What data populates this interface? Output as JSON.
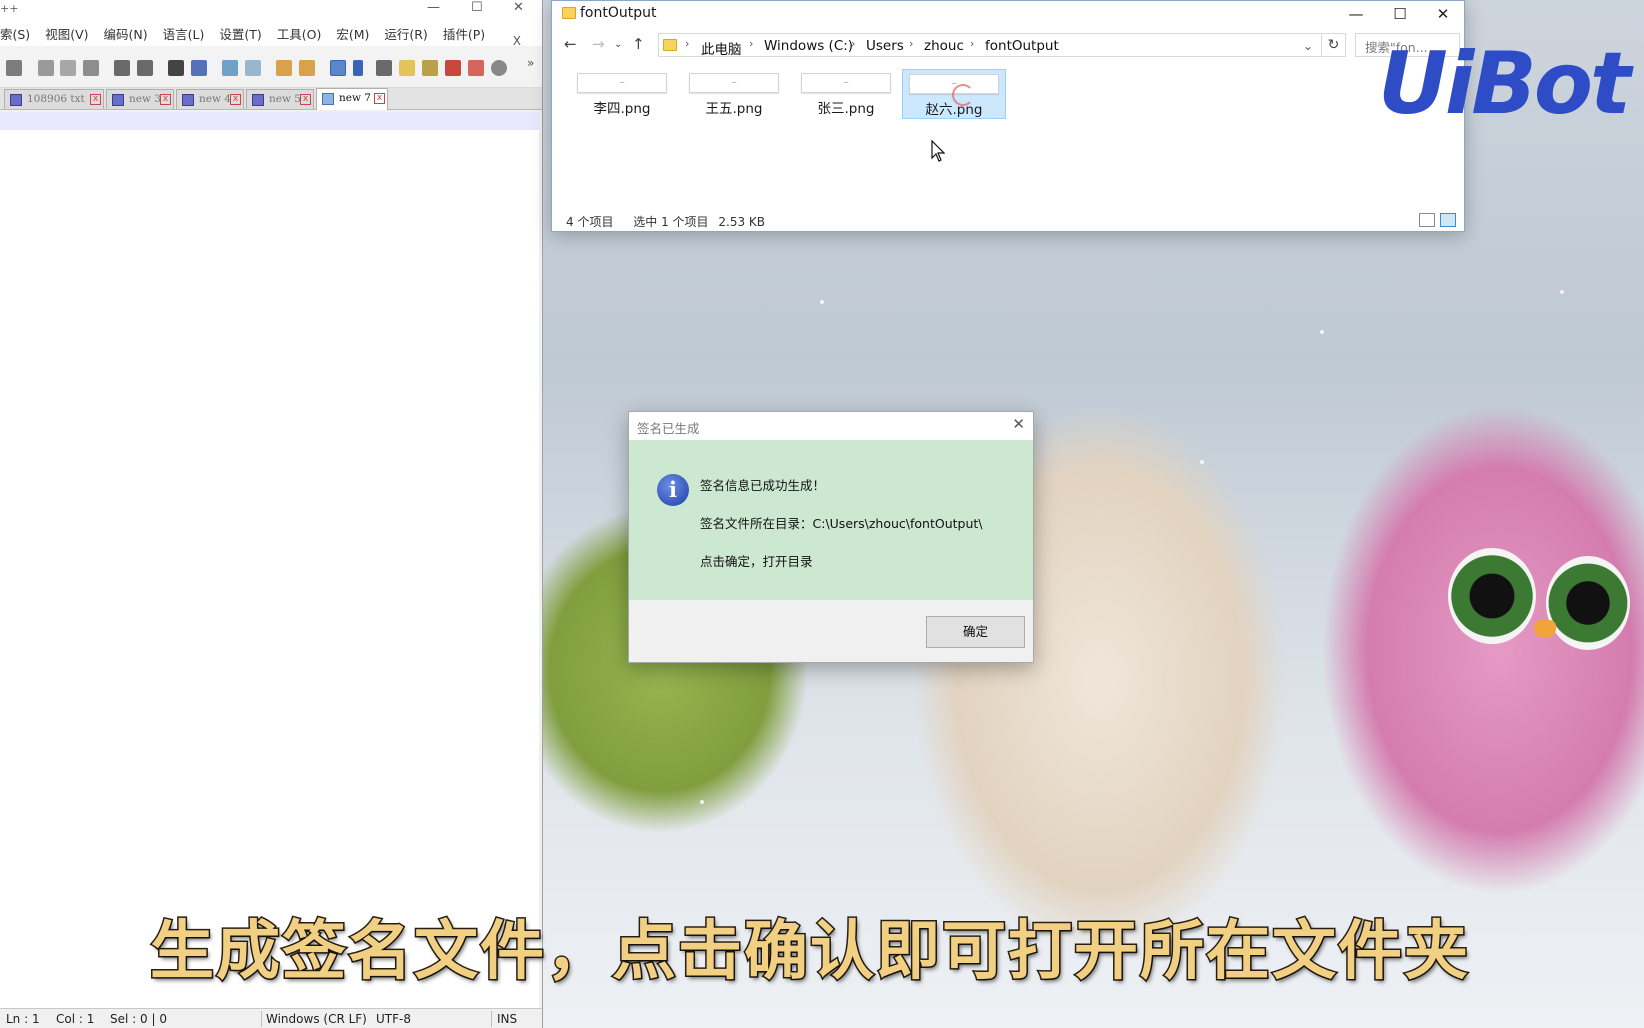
{
  "notepad": {
    "title_fragment": "++",
    "menu": [
      "索(S)",
      "视图(V)",
      "编码(N)",
      "语言(L)",
      "设置(T)",
      "工具(O)",
      "宏(M)",
      "运行(R)",
      "插件(P)"
    ],
    "menu_close": "X",
    "tabs": [
      {
        "label": "108906 txt",
        "active": false
      },
      {
        "label": "new 3",
        "active": false
      },
      {
        "label": "new 4",
        "active": false
      },
      {
        "label": "new 5",
        "active": false
      },
      {
        "label": "new 7",
        "active": true
      }
    ],
    "status": {
      "ln": "Ln : 1",
      "col": "Col : 1",
      "sel": "Sel : 0 | 0",
      "eol": "Windows (CR LF)",
      "encoding": "UTF-8",
      "mode": "INS"
    }
  },
  "explorer": {
    "title": "fontOutput",
    "path": [
      "此电脑",
      "Windows (C:)",
      "Users",
      "zhouc",
      "fontOutput"
    ],
    "search_placeholder": "搜索\"fon...",
    "files": [
      {
        "name": "李四.png",
        "selected": false
      },
      {
        "name": "王五.png",
        "selected": false
      },
      {
        "name": "张三.png",
        "selected": false
      },
      {
        "name": "赵六.png",
        "selected": true
      }
    ],
    "status_count": "4 个项目",
    "status_selected": "选中 1 个项目",
    "status_size": "2.53 KB"
  },
  "dialog": {
    "title": "签名已生成",
    "line1": "签名信息已成功生成！",
    "line2": "签名文件所在目录：C:\\Users\\zhouc\\fontOutput\\",
    "line3": "点击确定，打开目录",
    "ok_label": "确定"
  },
  "watermark": "UiBot",
  "subtitle": "生成签名文件，点击确认即可打开所在文件夹"
}
